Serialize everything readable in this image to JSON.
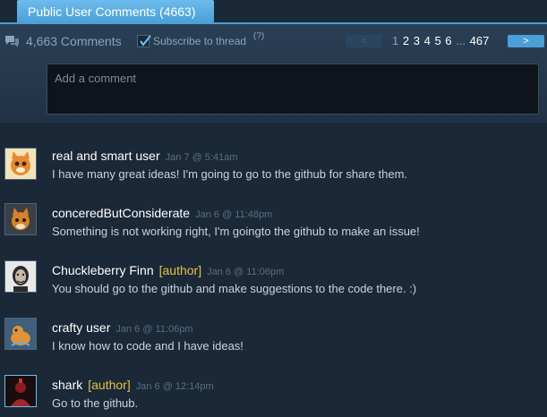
{
  "tab": {
    "label": "Public User Comments (4663)"
  },
  "header": {
    "count_label": "4,663 Comments",
    "subscribe_label": "Subscribe to thread",
    "subscribe_help": "(?)",
    "subscribe_checked": true
  },
  "pagination": {
    "prev_label": "<",
    "current": "1",
    "pages": [
      "2",
      "3",
      "4",
      "5",
      "6"
    ],
    "ellipsis": "...",
    "last": "467",
    "next_label": ">"
  },
  "compose": {
    "placeholder": "Add a comment"
  },
  "comments": [
    {
      "author": "real and smart user",
      "tag": "",
      "time": "Jan 7 @ 5:41am",
      "text": "I have many great ideas! I'm going to go to the github for share them.",
      "avatar": "cat-avatar"
    },
    {
      "author": "conceredButConsiderate",
      "tag": "",
      "time": "Jan 6 @ 11:48pm",
      "text": "Something is not working right, I'm goingto the github to make an issue!",
      "avatar": "fox-avatar"
    },
    {
      "author": "Chuckleberry Finn",
      "tag": "[author]",
      "time": "Jan 6 @ 11:06pm",
      "text": "You should go to the github and make suggestions to the code there. :)",
      "avatar": "portrait-avatar"
    },
    {
      "author": "crafty user",
      "tag": "",
      "time": "Jan 6 @ 11:06pm",
      "text": "I know how to code and I have ideas!",
      "avatar": "critter-avatar"
    },
    {
      "author": "shark",
      "tag": "[author]",
      "time": "Jan 6 @ 12:14pm",
      "text": "Go to the github.",
      "avatar": "red-figure-avatar"
    }
  ],
  "colors": {
    "accent": "#67c1f5",
    "author_tag": "#e4c440",
    "background": "#1b2838"
  }
}
